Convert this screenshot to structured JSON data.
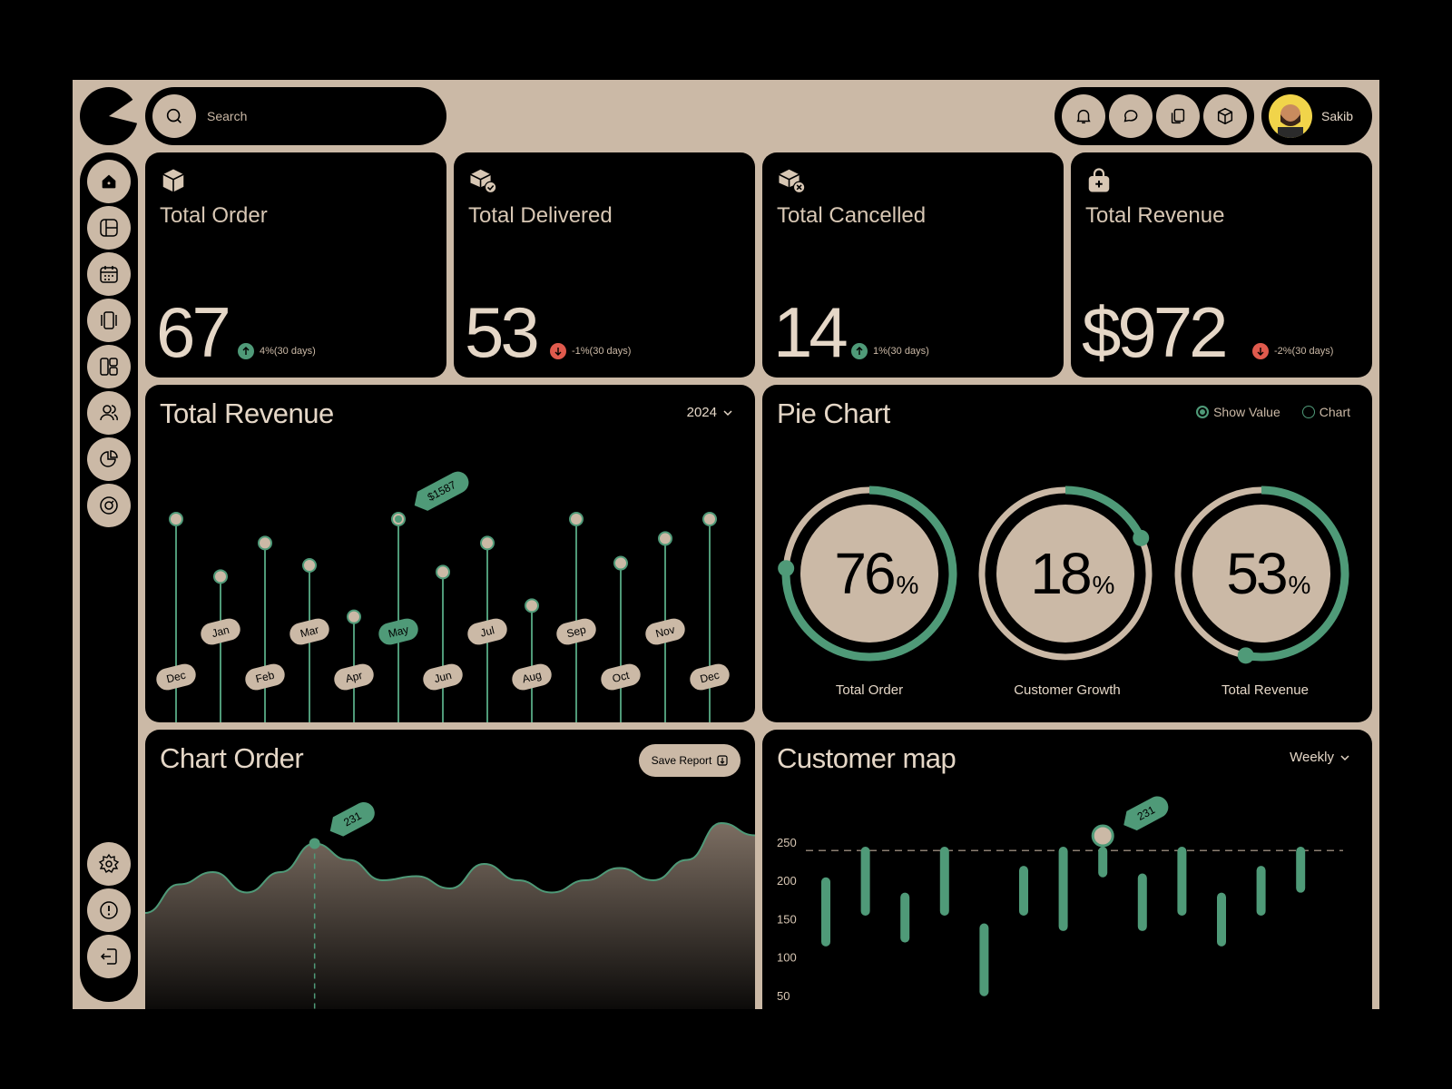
{
  "search": {
    "placeholder": "Search"
  },
  "header": {
    "user_name": "Sakib",
    "icons": [
      "bell-icon",
      "chat-icon",
      "copy-icon",
      "box-icon"
    ]
  },
  "sidebar": {
    "nav_icons": [
      "home-icon",
      "layout-icon",
      "calendar-icon",
      "carousel-icon",
      "grid-icon",
      "users-icon",
      "pie-icon",
      "target-icon"
    ],
    "bottom_icons": [
      "settings-icon",
      "info-icon",
      "logout-icon"
    ]
  },
  "stats": [
    {
      "title": "Total Order",
      "value": "67",
      "change": "4%(30 days)",
      "direction": "up"
    },
    {
      "title": "Total Delivered",
      "value": "53",
      "change": "-1%(30 days)",
      "direction": "down"
    },
    {
      "title": "Total Cancelled",
      "value": "14",
      "change": "1%(30 days)",
      "direction": "up"
    },
    {
      "title": "Total Revenue",
      "value": "$972",
      "change": "-2%(30 days)",
      "direction": "down"
    }
  ],
  "colors": {
    "accent": "#4f9a78",
    "down": "#e05a4d",
    "tan": "#cbb9a6",
    "bg": "#000000"
  },
  "revenue": {
    "title": "Total Revenue",
    "year": "2024"
  },
  "pie": {
    "title": "Pie Chart",
    "legend_value": "Show Value",
    "legend_chart": "Chart",
    "percent_sign": "%"
  },
  "order": {
    "title": "Chart Order",
    "save_label": "Save Report"
  },
  "map": {
    "title": "Customer map",
    "period": "Weekly"
  },
  "chart_data": [
    {
      "type": "lollipop",
      "title": "Total Revenue",
      "categories": [
        "Dec",
        "Jan",
        "Feb",
        "Mar",
        "Apr",
        "May",
        "Jun",
        "Jul",
        "Aug",
        "Sep",
        "Oct",
        "Nov",
        "Dec"
      ],
      "values": [
        1587,
        1330,
        1480,
        1380,
        1150,
        1587,
        1350,
        1480,
        1200,
        1587,
        1390,
        1500,
        1587
      ],
      "highlight_index": 5,
      "highlight_label": "$1587"
    },
    {
      "type": "pie",
      "title": "Pie Chart",
      "slices": [
        {
          "label": "Total Order",
          "percent": 76
        },
        {
          "label": "Customer Growth",
          "percent": 18
        },
        {
          "label": "Total Revenue",
          "percent": 53
        }
      ]
    },
    {
      "type": "area",
      "title": "Chart Order",
      "values": [
        120,
        155,
        170,
        145,
        170,
        205,
        185,
        160,
        165,
        150,
        180,
        160,
        145,
        160,
        175,
        160,
        185,
        230,
        215
      ],
      "highlight_index": 5,
      "highlight_label": "231"
    },
    {
      "type": "bar",
      "title": "Customer map",
      "yticks": [
        50,
        100,
        150,
        200,
        250
      ],
      "reference_line": 240,
      "ranges": [
        [
          115,
          205
        ],
        [
          155,
          245
        ],
        [
          120,
          185
        ],
        [
          155,
          245
        ],
        [
          50,
          145
        ],
        [
          155,
          220
        ],
        [
          135,
          245
        ],
        [
          205,
          245
        ],
        [
          135,
          210
        ],
        [
          155,
          245
        ],
        [
          115,
          185
        ],
        [
          155,
          220
        ],
        [
          185,
          245
        ]
      ],
      "highlight_index": 7,
      "highlight_label": "231"
    }
  ]
}
